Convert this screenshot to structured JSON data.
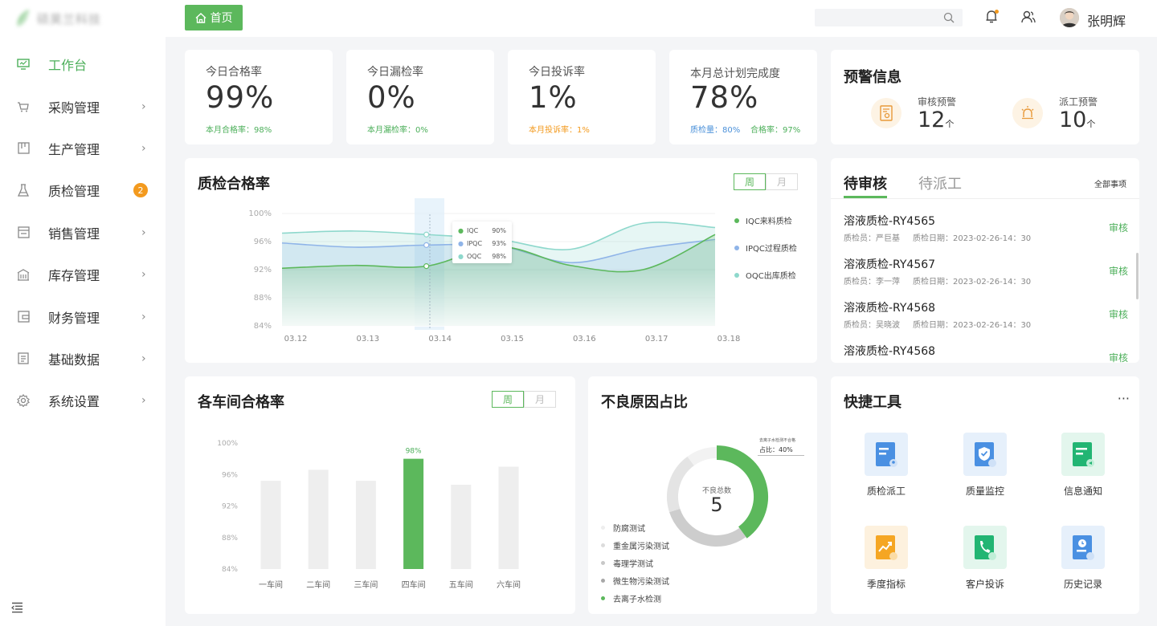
{
  "brand": {
    "name": "硕昊兰科技"
  },
  "sidebar": {
    "items": [
      {
        "label": "工作台",
        "icon": "dashboard-icon",
        "active": true
      },
      {
        "label": "采购管理",
        "icon": "cart-icon"
      },
      {
        "label": "生产管理",
        "icon": "production-icon"
      },
      {
        "label": "质检管理",
        "icon": "flask-icon",
        "badge": "2"
      },
      {
        "label": "销售管理",
        "icon": "store-icon"
      },
      {
        "label": "库存管理",
        "icon": "warehouse-icon"
      },
      {
        "label": "财务管理",
        "icon": "wallet-icon"
      },
      {
        "label": "基础数据",
        "icon": "list-icon"
      },
      {
        "label": "系统设置",
        "icon": "gear-icon"
      }
    ]
  },
  "header": {
    "home_label": "首页",
    "search_value": "",
    "user_name": "张明辉"
  },
  "kpis": [
    {
      "label": "今日合格率",
      "value": "99%",
      "sub": "本月合格率：98%",
      "sub_color": "#4caf5a"
    },
    {
      "label": "今日漏检率",
      "value": "0%",
      "sub": "本月漏检率：0%",
      "sub_color": "#4caf5a"
    },
    {
      "label": "今日投诉率",
      "value": "1%",
      "sub": "本月投诉率：1%",
      "sub_color": "#f39a1e"
    },
    {
      "label": "本月总计划完成度",
      "value": "78%",
      "sub1": "质检量：80%",
      "sub2": "合格率：97%",
      "sub_color": "#4a90d9",
      "sub2_color": "#4caf5a"
    }
  ],
  "warnings": {
    "title": "预警信息",
    "items": [
      {
        "label": "审核预警",
        "value": "12",
        "unit": "个",
        "icon": "audit-document-icon"
      },
      {
        "label": "派工预警",
        "value": "10",
        "unit": "个",
        "icon": "alarm-light-icon"
      }
    ]
  },
  "quality_chart": {
    "title": "质检合格率",
    "toggle": [
      "周",
      "月"
    ],
    "tooltip": [
      {
        "name": "IQC",
        "value": "90%"
      },
      {
        "name": "IPQC",
        "value": "93%"
      },
      {
        "name": "OQC",
        "value": "98%"
      }
    ]
  },
  "tasks": {
    "tabs": [
      "待审核",
      "待派工"
    ],
    "all_label": "全部事项",
    "items": [
      {
        "title": "溶液质检-RY4565",
        "inspector_label": "质检员：",
        "inspector": "严巨基",
        "date_label": "质检日期：",
        "date": "2023-02-26-14：30",
        "action": "审核"
      },
      {
        "title": "溶液质检-RY4567",
        "inspector_label": "质检员：",
        "inspector": "李一萍",
        "date_label": "质检日期：",
        "date": "2023-02-26-14：30",
        "action": "审核"
      },
      {
        "title": "溶液质检-RY4568",
        "inspector_label": "质检员：",
        "inspector": "吴晓波",
        "date_label": "质检日期：",
        "date": "2023-02-26-14：30",
        "action": "审核"
      },
      {
        "title": "溶液质检-RY4568",
        "inspector_label": "",
        "inspector": "",
        "date_label": "",
        "date": "",
        "action": "审核"
      }
    ]
  },
  "workshop_chart": {
    "title": "各车间合格率",
    "toggle": [
      "周",
      "月"
    ]
  },
  "defect_chart": {
    "title": "不良原因占比",
    "center_label": "不良总数",
    "center_value": "5",
    "callout_title": "去离子水检测不合格",
    "callout_value": "占比：40%",
    "reasons": [
      {
        "label": "防腐测试",
        "color": "#eeeeee"
      },
      {
        "label": "重金属污染测试",
        "color": "#dcdcdc"
      },
      {
        "label": "毒理学测试",
        "color": "#c8c8c8"
      },
      {
        "label": "微生物污染测试",
        "color": "#a8a8a8"
      },
      {
        "label": "去离子水检测",
        "color": "#5cb85c"
      }
    ]
  },
  "tools": {
    "title": "快捷工具",
    "more": "···",
    "items": [
      {
        "label": "质检派工",
        "icon": "dispatch-icon",
        "color": "#4a90e2",
        "bg": "#e6f0fb"
      },
      {
        "label": "质量监控",
        "icon": "shield-check-icon",
        "color": "#4a90e2",
        "bg": "#e6f0fb"
      },
      {
        "label": "信息通知",
        "icon": "notice-icon",
        "color": "#22b573",
        "bg": "#e3f6ed"
      },
      {
        "label": "季度指标",
        "icon": "trend-chart-icon",
        "color": "#f5a623",
        "bg": "#fdf1de"
      },
      {
        "label": "客户投诉",
        "icon": "phone-icon",
        "color": "#22b573",
        "bg": "#e3f6ed"
      },
      {
        "label": "历史记录",
        "icon": "history-icon",
        "color": "#4a90e2",
        "bg": "#e6f0fb"
      }
    ]
  },
  "chart_data": [
    {
      "type": "line",
      "title": "质检合格率",
      "categories": [
        "03.12",
        "03.13",
        "03.14",
        "03.15",
        "03.16",
        "03.17",
        "03.18"
      ],
      "y_ticks": [
        "100%",
        "96%",
        "92%",
        "88%",
        "84%"
      ],
      "ylim": [
        84,
        100
      ],
      "legend_position": "right",
      "series": [
        {
          "name": "IQC来料质检",
          "color": "#5cb85c",
          "values": [
            92.2,
            92.6,
            92.5,
            95.3,
            92.6,
            92.0,
            97.0
          ]
        },
        {
          "name": "IPQC过程质检",
          "color": "#8fb4e8",
          "values": [
            95.8,
            95.2,
            95.5,
            95.4,
            93.0,
            95.0,
            96.3
          ]
        },
        {
          "name": "OQC出库质检",
          "color": "#8ed8cc",
          "values": [
            97.2,
            97.5,
            97.0,
            96.3,
            94.9,
            98.6,
            98.0
          ]
        }
      ]
    },
    {
      "type": "bar",
      "title": "各车间合格率",
      "categories": [
        "一车间",
        "二车间",
        "三车间",
        "四车间",
        "五车间",
        "六车间"
      ],
      "values": [
        95.2,
        96.6,
        95.2,
        98.0,
        94.7,
        97.0
      ],
      "highlight_index": 3,
      "highlight_label": "98%",
      "y_ticks": [
        "100%",
        "96%",
        "92%",
        "88%",
        "84%"
      ],
      "ylim": [
        84,
        100
      ]
    },
    {
      "type": "pie",
      "title": "不良原因占比",
      "labels": [
        "去离子水检测",
        "毒理学测试",
        "重金属污染测试",
        "防腐测试"
      ],
      "values": [
        40,
        30,
        20,
        10
      ]
    }
  ]
}
